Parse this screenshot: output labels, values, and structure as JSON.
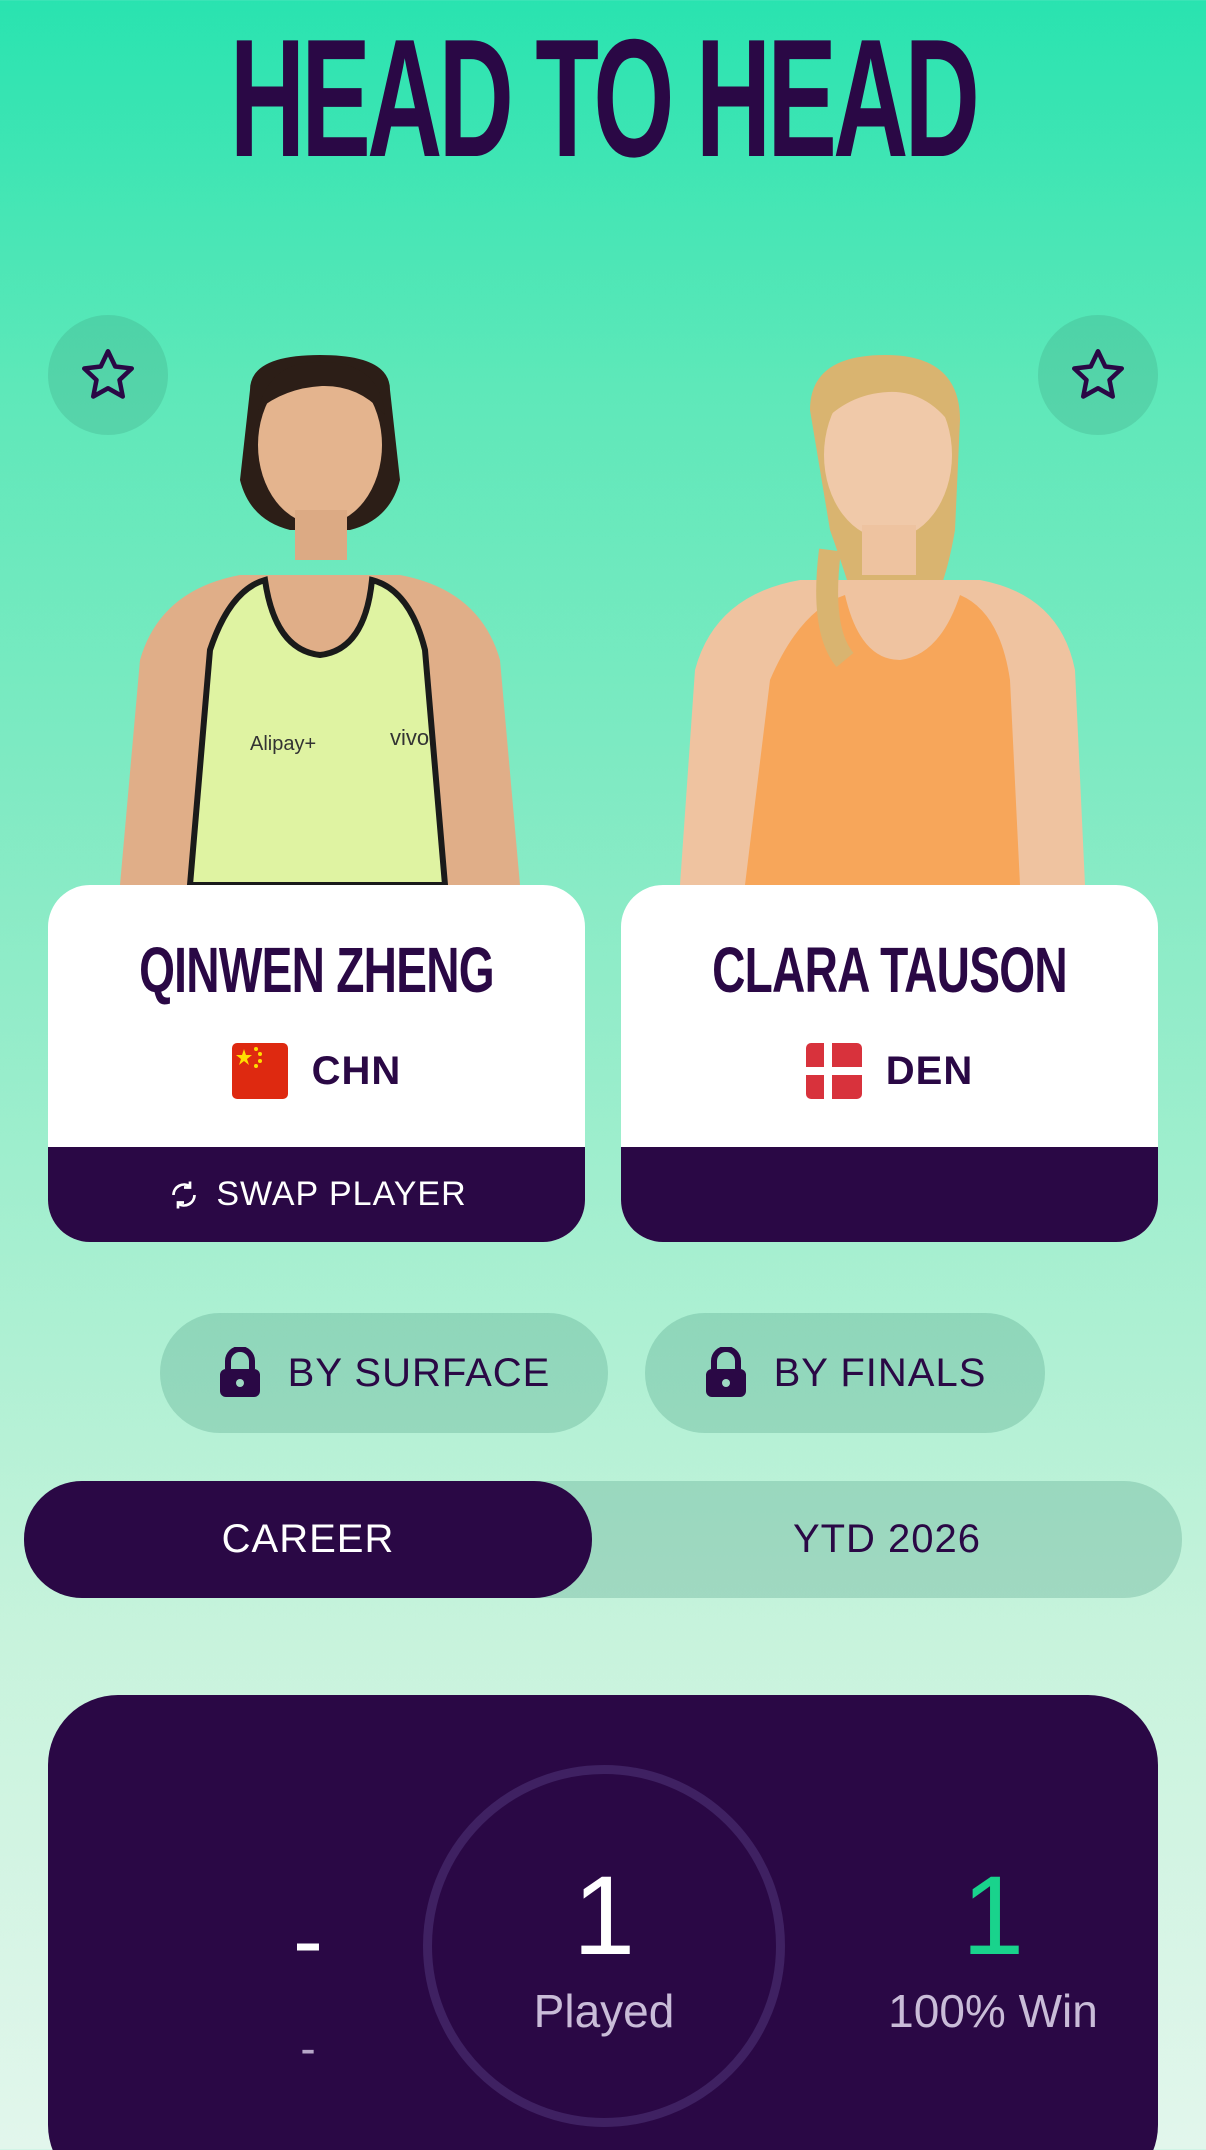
{
  "header": {
    "title": "HEAD TO HEAD"
  },
  "players": [
    {
      "name": "QINWEN ZHENG",
      "country_code": "CHN",
      "swap_label": "SWAP PLAYER",
      "shirt_color": "#dff3a2",
      "flag": "china-flag"
    },
    {
      "name": "CLARA TAUSON",
      "country_code": "DEN",
      "swap_label": "",
      "shirt_color": "#f7a65a",
      "flag": "denmark-flag"
    }
  ],
  "filters": {
    "surface_label": "BY SURFACE",
    "finals_label": "BY FINALS"
  },
  "period_tabs": {
    "career_label": "CAREER",
    "ytd_label": "YTD 2026",
    "selected": "CAREER"
  },
  "stats": {
    "left_value": "-",
    "left_label": "-",
    "center_value": "1",
    "center_label": "Played",
    "right_value": "1",
    "right_label": "100% Win"
  },
  "colors": {
    "primary": "#2a0845",
    "accent_green": "#19d38c",
    "bg_top": "#29e3b0"
  }
}
